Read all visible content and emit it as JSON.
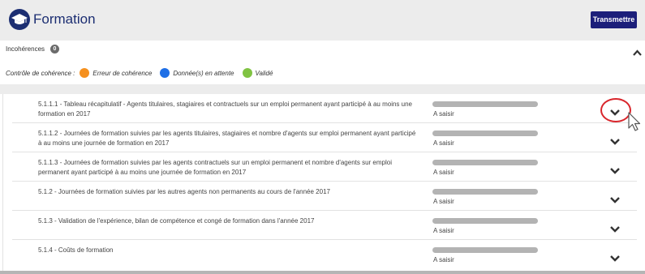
{
  "header": {
    "title": "Formation",
    "logo_icon": "graduation-cap-icon",
    "transmit_label": "Transmettre",
    "colors": {
      "brand": "#1c2e72",
      "button": "#1c1f7a"
    }
  },
  "incoherences": {
    "label": "Incohérences",
    "count": "0",
    "toggle_icon": "chevron-up-icon"
  },
  "legend": {
    "title": "Contrôle de cohérence :",
    "items": [
      {
        "label": "Erreur de cohérence",
        "color": "#f5901e"
      },
      {
        "label": "Donnée(s) en attente",
        "color": "#1e6fe6"
      },
      {
        "label": "Validé",
        "color": "#80c342"
      }
    ]
  },
  "rows": [
    {
      "title": "5.1.1.1 - Tableau récapitulatif - Agents titulaires, stagiaires et contractuels sur un emploi permanent ayant participé à au moins une formation en 2017",
      "status": "A saisir",
      "progress": 0
    },
    {
      "title": "5.1.1.2 - Journées de formation suivies par les agents titulaires, stagiaires et nombre d'agents sur emploi permanent ayant participé à au moins une journée de formation en 2017",
      "status": "A saisir",
      "progress": 0
    },
    {
      "title": "5.1.1.3 - Journées de formation suivies par les agents contractuels sur un emploi permanent et nombre d'agents sur emploi permanent ayant participé à au moins une journée de formation en 2017",
      "status": "A saisir",
      "progress": 0
    },
    {
      "title": "5.1.2 - Journées de formation suivies par les autres agents non permanents au cours de l'année 2017",
      "status": "A saisir",
      "progress": 0
    },
    {
      "title": "5.1.3 - Validation de l'expérience, bilan de compétence et congé de formation dans l'année 2017",
      "status": "A saisir",
      "progress": 0
    },
    {
      "title": "5.1.4 - Coûts de formation",
      "status": "A saisir",
      "progress": 0
    }
  ],
  "row_toggle_icon": "chevron-down-icon",
  "annotation_color": "#d9262c"
}
